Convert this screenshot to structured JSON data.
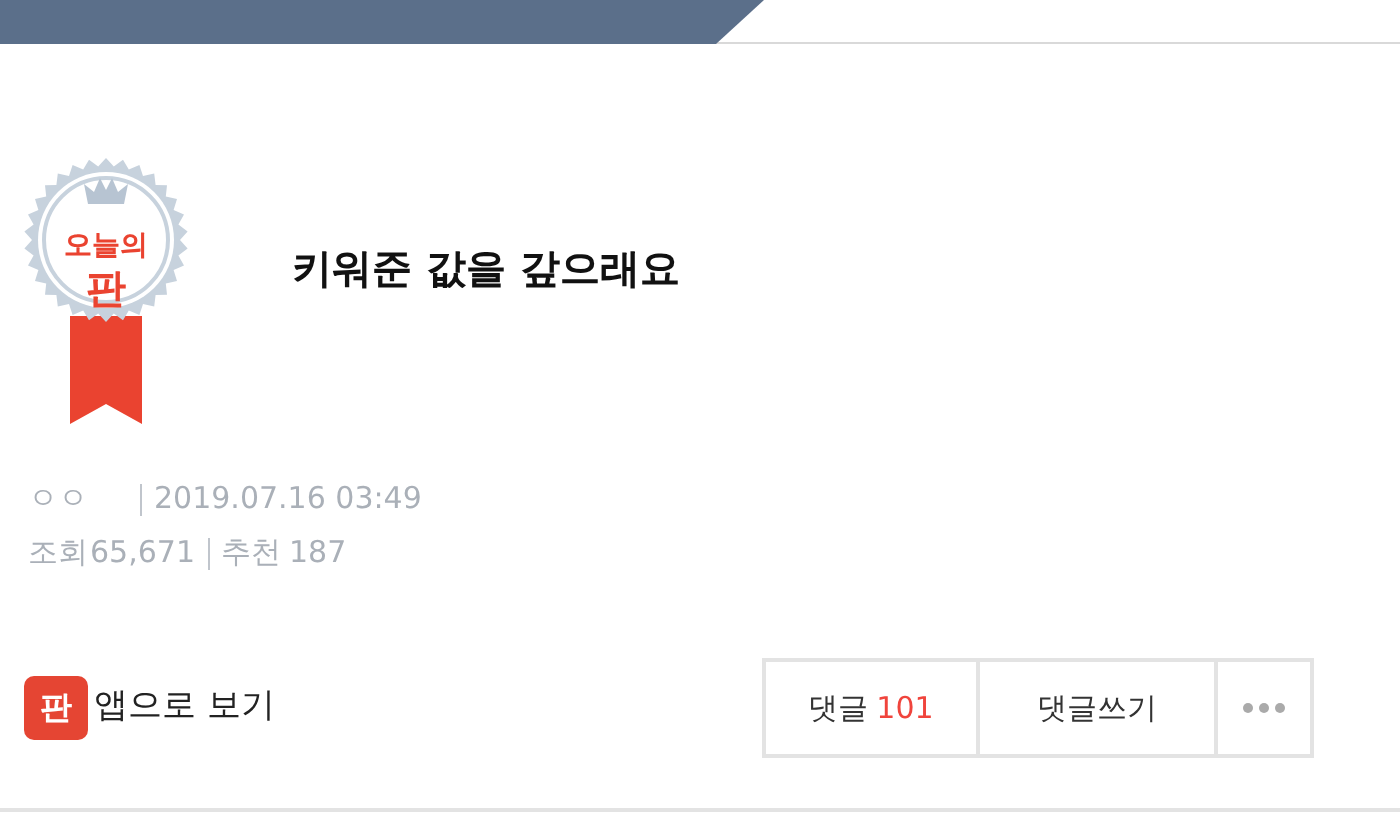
{
  "badge": {
    "line1": "오늘의",
    "line2": "판"
  },
  "title": "키워준 값을 갚으래요",
  "meta": {
    "author": "ㅇㅇ",
    "date": "2019.07.16 03:49",
    "views_label": "조회",
    "views": "65,671",
    "recommend_label": "추천",
    "recommend": "187"
  },
  "app_link": {
    "icon_text": "판",
    "label": "앱으로 보기"
  },
  "actions": {
    "comments_label": "댓글",
    "comments_count": "101",
    "write_label": "댓글쓰기"
  }
}
